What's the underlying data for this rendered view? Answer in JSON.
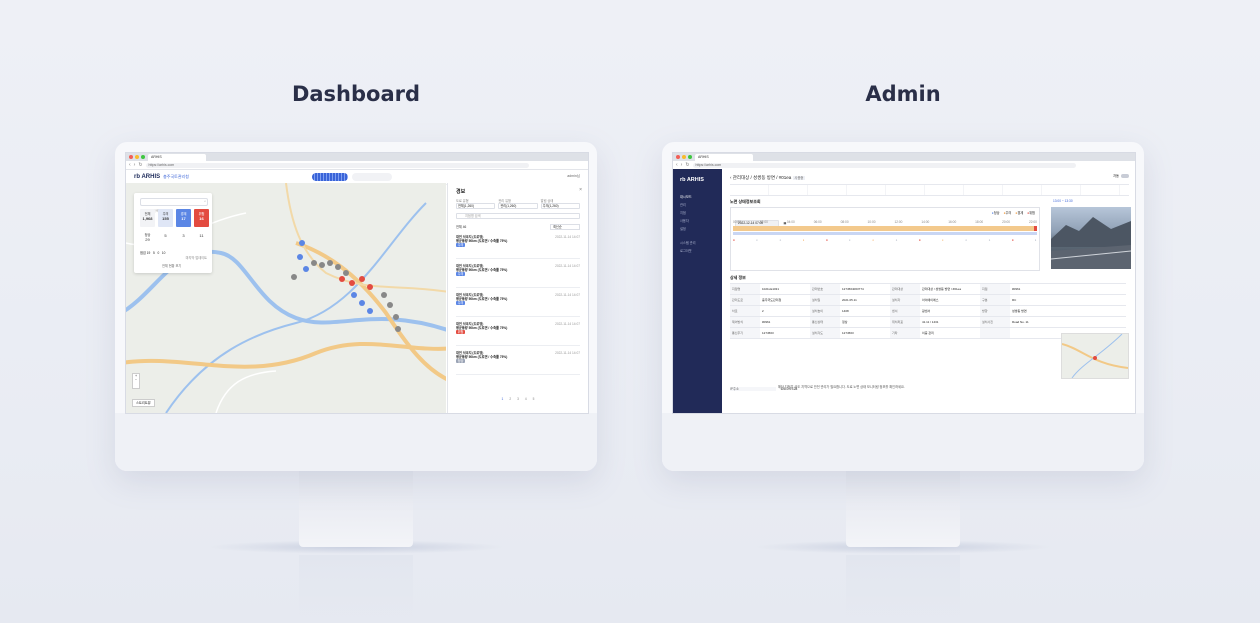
{
  "headings": {
    "dashboard": "Dashboard",
    "admin": "Admin"
  },
  "colors": {
    "accent": "#3a64d8",
    "admin_sidebar": "#212a58",
    "alert_red": "#e34b40",
    "warning_orange": "#f39a3a",
    "ok_blue": "#5b86e5",
    "map_road": "#f2c987"
  },
  "dashboard_screen": {
    "browser": {
      "tab_title": "ARHIS",
      "url": "https://arhis.com"
    },
    "logo": "rb ARHIS",
    "logo_sub": "충주국토관리청",
    "header_right": "admin님",
    "stats": {
      "search_placeholder": "지점명 검색",
      "cells": [
        {
          "label": "전체",
          "value": "1,968"
        },
        {
          "label": "주의",
          "value": "155"
        },
        {
          "label": "경계",
          "value": "17"
        },
        {
          "label": "위험",
          "value": "16"
        },
        {
          "label": "정상",
          "value": "29"
        },
        {
          "label": "",
          "value": "5"
        },
        {
          "label": "",
          "value": "3"
        },
        {
          "label": "",
          "value": "11"
        },
        {
          "label": "점검",
          "value": "19"
        },
        {
          "label": "",
          "value": "5"
        },
        {
          "label": "",
          "value": "0"
        },
        {
          "label": "",
          "value": "10"
        }
      ],
      "updated": "마지막 업데이트",
      "footer_button": "전체 현황 보기"
    },
    "map_footer": "스트리트뷰",
    "panel": {
      "title": "경보",
      "filter_labels": [
        "도로 유형",
        "관리 유형",
        "알림 상태"
      ],
      "filter_values": [
        "전체(1,260)",
        "관리(1,260)",
        "주의(1,260)"
      ],
      "search_placeholder": "지점명 검색",
      "count_label": "전체 46",
      "sort": "최신순",
      "alerts": [
        {
          "title": "대전 석곡지 (도로명)",
          "desc": "평균풍량 50km (도로면 / 수축률 75%)",
          "time": "2022-11-14 14:07",
          "badge": "주의"
        },
        {
          "title": "대전 석곡지 (도로명)",
          "desc": "평균풍량 50km (도로면 / 수축률 75%)",
          "time": "2022-11-14 14:07",
          "badge": "주의"
        },
        {
          "title": "대전 석곡지 (도로명)",
          "desc": "평균풍량 50km (도로면 / 수축률 75%)",
          "time": "2022-11-14 14:07",
          "badge": "주의"
        },
        {
          "title": "대전 석곡지 (도로명)",
          "desc": "평균풍량 50km (도로면 / 수축률 75%)",
          "time": "2022-11-14 14:07",
          "badge": "위험"
        },
        {
          "title": "대전 석곡지 (도로명)",
          "desc": "평균풍량 50km (도로면 / 수축률 75%)",
          "time": "2022-11-14 14:07",
          "badge": "정상"
        }
      ],
      "pagination": [
        "1",
        "2",
        "3",
        "4",
        "5"
      ]
    }
  },
  "admin_screen": {
    "browser": {
      "tab_title": "ARHIS",
      "url": "https://arhis.com"
    },
    "logo": "rb ARHIS",
    "sidebar_items": [
      "대시보드",
      "관리",
      "지점",
      "사용자",
      "설정",
      "시스템 관리",
      "로그아웃"
    ],
    "breadcrumb": "관리대상 / 성쌍동 방면 / #01ea",
    "breadcrumb_tag": "사용중",
    "toggle_label": "자동",
    "section_title": "노면 상태정보조회",
    "date": "2022-12-14 07:00",
    "photo_time": "13:00 ~ 13:30",
    "legend": [
      "정상",
      "주의",
      "경계",
      "위험"
    ],
    "hours": [
      "00:00",
      "02:00",
      "04:00",
      "06:00",
      "08:00",
      "10:00",
      "12:00",
      "14:00",
      "16:00",
      "18:00",
      "20:00",
      "22:00"
    ],
    "detail_title": "상세 정보",
    "table": [
      [
        "지점명",
        "1021LE1031",
        "관리번호",
        "1274564063774",
        "관리대상",
        "관리대상 / 성쌍동 방면 / #01ea",
        "지점",
        "#0961"
      ],
      [
        "관리도로",
        "충주국도관리청",
        "설치일",
        "2021.05.11",
        "설치자",
        "아이에이에스",
        "구분",
        "RC"
      ],
      [
        "차로",
        "2",
        "설치높이",
        "1408",
        "센서",
        "광센서",
        "방향",
        "성쌍동 방면"
      ],
      [
        "제어방식",
        "#0961",
        "통신상태",
        "정상",
        "위치좌표",
        "41.11 / 1431",
        "설치사진",
        "Road No. 11"
      ],
      [
        "통신주기",
        "1274563",
        "설치각도",
        "1274563",
        "기타",
        "이중 관리",
        "",
        ""
      ]
    ],
    "ip_row": {
      "label": "IP주소",
      "value": "128.0.0.128"
    },
    "note": "해당 지점은 국도 지역으로 안전 관리가 필요합니다. 도로 노면 상태 모니터링 정보를 확인하세요."
  }
}
